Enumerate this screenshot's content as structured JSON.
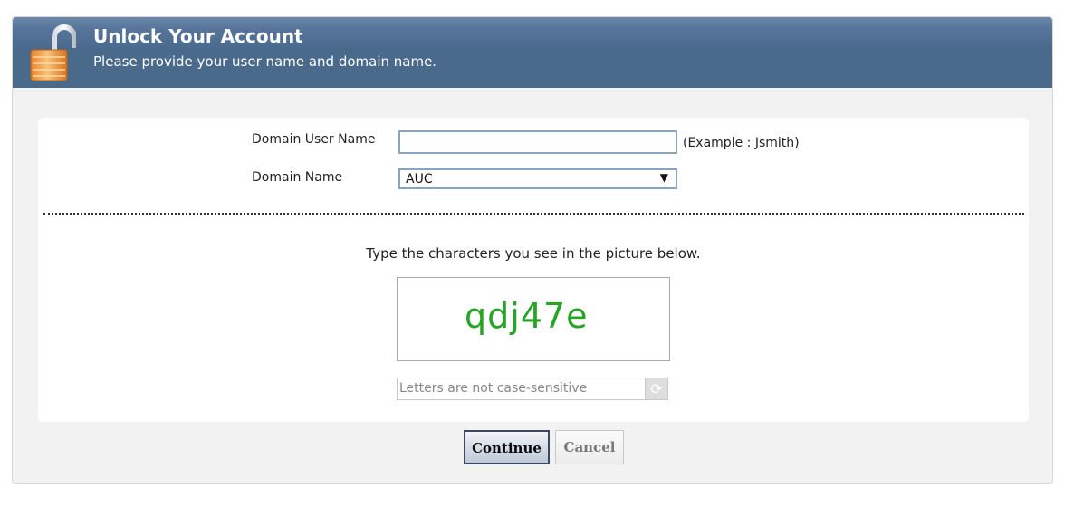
{
  "header": {
    "title": "Unlock Your Account",
    "subtitle": "Please provide your user name and domain name.",
    "icon": "unlock-padlock-icon"
  },
  "form": {
    "username_label": "Domain User Name",
    "username_value": "",
    "username_example": "(Example : Jsmith)",
    "domain_label": "Domain Name",
    "domain_selected": "AUC"
  },
  "captcha": {
    "instruction": "Type the characters you see in the picture below.",
    "image_text": "qdj47e",
    "input_placeholder": "Letters are not case-sensitive",
    "refresh_icon": "refresh-icon",
    "image_color": "#27a327"
  },
  "buttons": {
    "continue_label": "Continue",
    "cancel_label": "Cancel"
  },
  "colors": {
    "header_bg": "#4a6a8c",
    "input_border": "#8aa4bb"
  }
}
